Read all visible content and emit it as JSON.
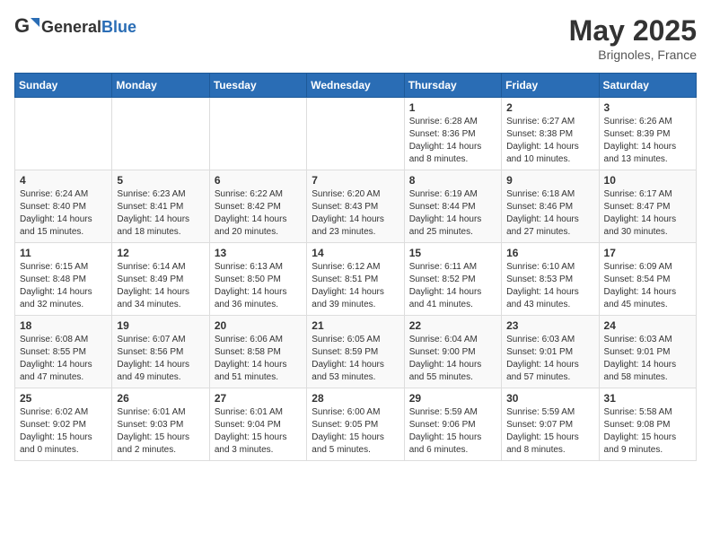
{
  "header": {
    "logo_general": "General",
    "logo_blue": "Blue",
    "title": "May 2025",
    "location": "Brignoles, France"
  },
  "calendar": {
    "weekdays": [
      "Sunday",
      "Monday",
      "Tuesday",
      "Wednesday",
      "Thursday",
      "Friday",
      "Saturday"
    ],
    "weeks": [
      [
        {
          "day": "",
          "info": ""
        },
        {
          "day": "",
          "info": ""
        },
        {
          "day": "",
          "info": ""
        },
        {
          "day": "",
          "info": ""
        },
        {
          "day": "1",
          "info": "Sunrise: 6:28 AM\nSunset: 8:36 PM\nDaylight: 14 hours\nand 8 minutes."
        },
        {
          "day": "2",
          "info": "Sunrise: 6:27 AM\nSunset: 8:38 PM\nDaylight: 14 hours\nand 10 minutes."
        },
        {
          "day": "3",
          "info": "Sunrise: 6:26 AM\nSunset: 8:39 PM\nDaylight: 14 hours\nand 13 minutes."
        }
      ],
      [
        {
          "day": "4",
          "info": "Sunrise: 6:24 AM\nSunset: 8:40 PM\nDaylight: 14 hours\nand 15 minutes."
        },
        {
          "day": "5",
          "info": "Sunrise: 6:23 AM\nSunset: 8:41 PM\nDaylight: 14 hours\nand 18 minutes."
        },
        {
          "day": "6",
          "info": "Sunrise: 6:22 AM\nSunset: 8:42 PM\nDaylight: 14 hours\nand 20 minutes."
        },
        {
          "day": "7",
          "info": "Sunrise: 6:20 AM\nSunset: 8:43 PM\nDaylight: 14 hours\nand 23 minutes."
        },
        {
          "day": "8",
          "info": "Sunrise: 6:19 AM\nSunset: 8:44 PM\nDaylight: 14 hours\nand 25 minutes."
        },
        {
          "day": "9",
          "info": "Sunrise: 6:18 AM\nSunset: 8:46 PM\nDaylight: 14 hours\nand 27 minutes."
        },
        {
          "day": "10",
          "info": "Sunrise: 6:17 AM\nSunset: 8:47 PM\nDaylight: 14 hours\nand 30 minutes."
        }
      ],
      [
        {
          "day": "11",
          "info": "Sunrise: 6:15 AM\nSunset: 8:48 PM\nDaylight: 14 hours\nand 32 minutes."
        },
        {
          "day": "12",
          "info": "Sunrise: 6:14 AM\nSunset: 8:49 PM\nDaylight: 14 hours\nand 34 minutes."
        },
        {
          "day": "13",
          "info": "Sunrise: 6:13 AM\nSunset: 8:50 PM\nDaylight: 14 hours\nand 36 minutes."
        },
        {
          "day": "14",
          "info": "Sunrise: 6:12 AM\nSunset: 8:51 PM\nDaylight: 14 hours\nand 39 minutes."
        },
        {
          "day": "15",
          "info": "Sunrise: 6:11 AM\nSunset: 8:52 PM\nDaylight: 14 hours\nand 41 minutes."
        },
        {
          "day": "16",
          "info": "Sunrise: 6:10 AM\nSunset: 8:53 PM\nDaylight: 14 hours\nand 43 minutes."
        },
        {
          "day": "17",
          "info": "Sunrise: 6:09 AM\nSunset: 8:54 PM\nDaylight: 14 hours\nand 45 minutes."
        }
      ],
      [
        {
          "day": "18",
          "info": "Sunrise: 6:08 AM\nSunset: 8:55 PM\nDaylight: 14 hours\nand 47 minutes."
        },
        {
          "day": "19",
          "info": "Sunrise: 6:07 AM\nSunset: 8:56 PM\nDaylight: 14 hours\nand 49 minutes."
        },
        {
          "day": "20",
          "info": "Sunrise: 6:06 AM\nSunset: 8:58 PM\nDaylight: 14 hours\nand 51 minutes."
        },
        {
          "day": "21",
          "info": "Sunrise: 6:05 AM\nSunset: 8:59 PM\nDaylight: 14 hours\nand 53 minutes."
        },
        {
          "day": "22",
          "info": "Sunrise: 6:04 AM\nSunset: 9:00 PM\nDaylight: 14 hours\nand 55 minutes."
        },
        {
          "day": "23",
          "info": "Sunrise: 6:03 AM\nSunset: 9:01 PM\nDaylight: 14 hours\nand 57 minutes."
        },
        {
          "day": "24",
          "info": "Sunrise: 6:03 AM\nSunset: 9:01 PM\nDaylight: 14 hours\nand 58 minutes."
        }
      ],
      [
        {
          "day": "25",
          "info": "Sunrise: 6:02 AM\nSunset: 9:02 PM\nDaylight: 15 hours\nand 0 minutes."
        },
        {
          "day": "26",
          "info": "Sunrise: 6:01 AM\nSunset: 9:03 PM\nDaylight: 15 hours\nand 2 minutes."
        },
        {
          "day": "27",
          "info": "Sunrise: 6:01 AM\nSunset: 9:04 PM\nDaylight: 15 hours\nand 3 minutes."
        },
        {
          "day": "28",
          "info": "Sunrise: 6:00 AM\nSunset: 9:05 PM\nDaylight: 15 hours\nand 5 minutes."
        },
        {
          "day": "29",
          "info": "Sunrise: 5:59 AM\nSunset: 9:06 PM\nDaylight: 15 hours\nand 6 minutes."
        },
        {
          "day": "30",
          "info": "Sunrise: 5:59 AM\nSunset: 9:07 PM\nDaylight: 15 hours\nand 8 minutes."
        },
        {
          "day": "31",
          "info": "Sunrise: 5:58 AM\nSunset: 9:08 PM\nDaylight: 15 hours\nand 9 minutes."
        }
      ]
    ]
  }
}
